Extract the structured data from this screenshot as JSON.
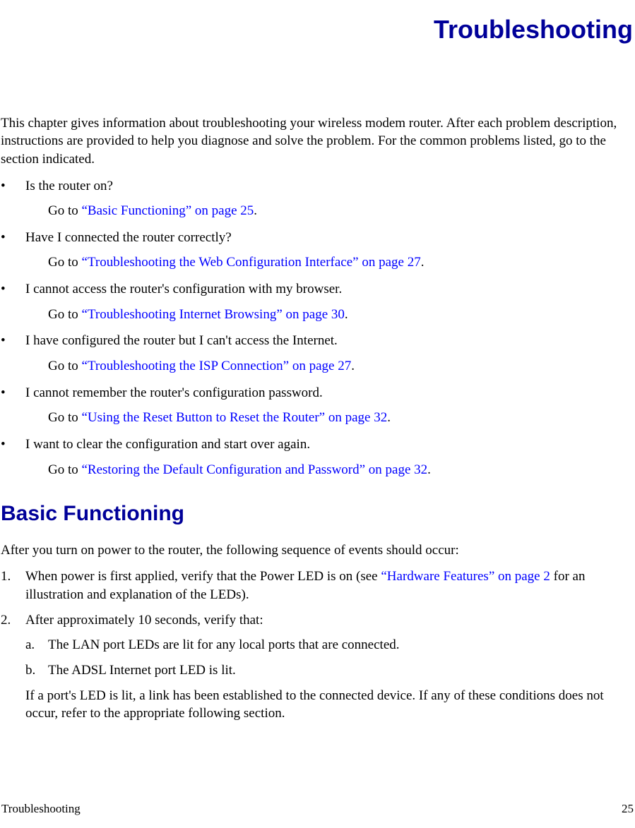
{
  "title": "Troubleshooting",
  "intro": "This chapter gives information about troubleshooting your wireless modem router. After each problem description, instructions are provided to help you diagnose and solve the problem. For the common problems listed, go to the section indicated.",
  "bullets": [
    {
      "q": "Is the router on?",
      "goto_prefix": "Go to ",
      "link": "“Basic Functioning” on page 25",
      "suffix": "."
    },
    {
      "q": "Have I connected the router correctly?",
      "goto_prefix": "Go to ",
      "link": "“Troubleshooting the Web Configuration Interface” on page 27",
      "suffix": "."
    },
    {
      "q": "I cannot access the router's configuration with my browser.",
      "goto_prefix": "Go to ",
      "link": "“Troubleshooting Internet Browsing” on page 30",
      "suffix": "."
    },
    {
      "q": "I have configured the router but I can't access the Internet.",
      "goto_prefix": "Go to ",
      "link": "“Troubleshooting the ISP Connection” on page 27",
      "suffix": "."
    },
    {
      "q": "I cannot remember the router's configuration password.",
      "goto_prefix": "Go to ",
      "link": "“Using the Reset Button to Reset the Router” on page 32",
      "suffix": "."
    },
    {
      "q": "I want to clear the configuration and start over again.",
      "goto_prefix": "Go to ",
      "link": "“Restoring the Default Configuration and Password” on page 32",
      "suffix": "."
    }
  ],
  "section_heading": "Basic Functioning",
  "section_intro": "After you turn on power to the router, the following sequence of events should occur:",
  "ordered": {
    "item1_num": "1.",
    "item1_pre": "When power is first applied, verify that the Power LED is on (see ",
    "item1_link": "“Hardware Features” on page 2",
    "item1_post": " for an illustration and explanation of the LEDs).",
    "item2_num": "2.",
    "item2_text": "After approximately 10 seconds, verify that:",
    "sub_a_mark": "a.",
    "sub_a_text": "The LAN port LEDs are lit for any local ports that are connected.",
    "sub_b_mark": "b.",
    "sub_b_text": "The ADSL Internet port LED is lit.",
    "tail": "If a port's LED is lit, a link has been established to the connected device. If any of these conditions does not occur, refer to the appropriate following section."
  },
  "footer": {
    "left": "Troubleshooting",
    "right": "25"
  }
}
